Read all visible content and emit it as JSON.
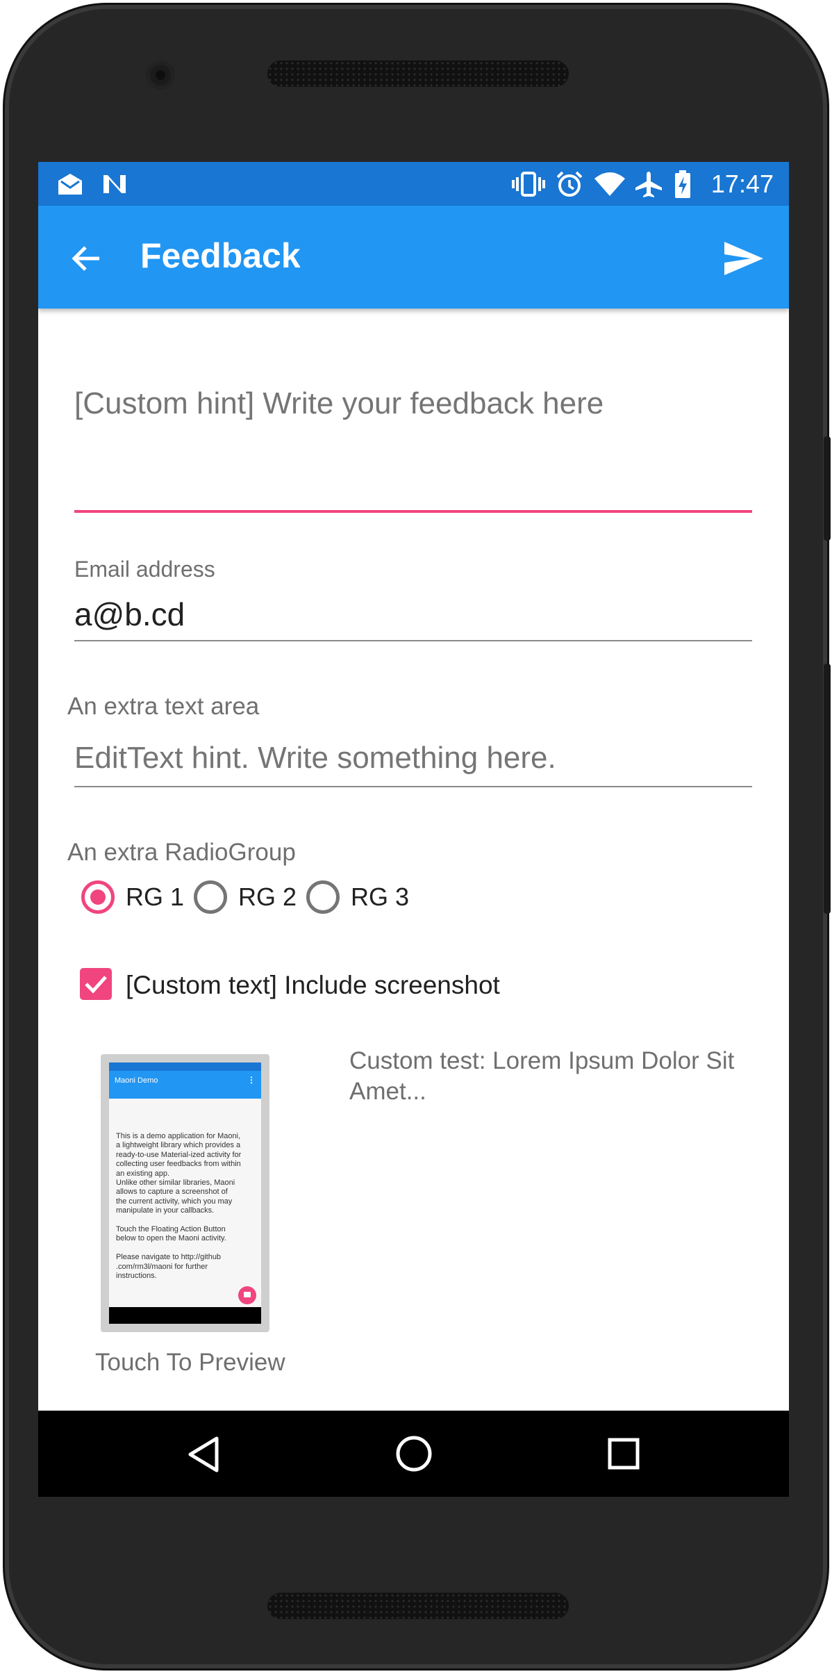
{
  "status_bar": {
    "time": "17:47",
    "icons": [
      "mail-notification-icon",
      "n-notification-icon",
      "vibrate-icon",
      "alarm-icon",
      "wifi-icon",
      "airplane-icon",
      "battery-charging-icon"
    ]
  },
  "toolbar": {
    "title": "Feedback",
    "back_icon": "arrow-back-icon",
    "send_icon": "send-icon"
  },
  "feedback_field": {
    "placeholder": "[Custom hint] Write your feedback here",
    "accent": "#F0457F"
  },
  "email_field": {
    "label": "Email address",
    "value": "a@b.cd"
  },
  "extra_text_area": {
    "label": "An extra text area",
    "placeholder": "EditText hint. Write something here."
  },
  "radio_group": {
    "label": "An extra RadioGroup",
    "options": [
      {
        "label": "RG 1",
        "selected": true
      },
      {
        "label": "RG 2",
        "selected": false
      },
      {
        "label": "RG 3",
        "selected": false
      }
    ]
  },
  "screenshot_checkbox": {
    "label": "[Custom text] Include screenshot",
    "checked": true
  },
  "preview": {
    "caption": "Touch To Preview",
    "custom_text": "Custom test: Lorem Ipsum Dolor Sit Amet...",
    "thumb_title": "Maoni Demo",
    "thumb_body": "This is a demo application for Maoni,\na lightweight library which provides a\nready-to-use Material-ized activity for\ncollecting user feedbacks from within\nan existing app.\n Unlike other similar libraries, Maoni\nallows to capture a screenshot of\nthe current activity, which you may\nmanipulate in your callbacks.\n\n Touch the Floating Action Button\nbelow to open the Maoni activity.\n\n Please navigate to http://github\n.com/rm3l/maoni for further\ninstructions."
  },
  "nav_bar": {
    "back": "nav-back-icon",
    "home": "nav-home-icon",
    "recents": "nav-recents-icon"
  },
  "colors": {
    "primary": "#2196F3",
    "primary_dark": "#1976D2",
    "accent": "#F0457F"
  }
}
